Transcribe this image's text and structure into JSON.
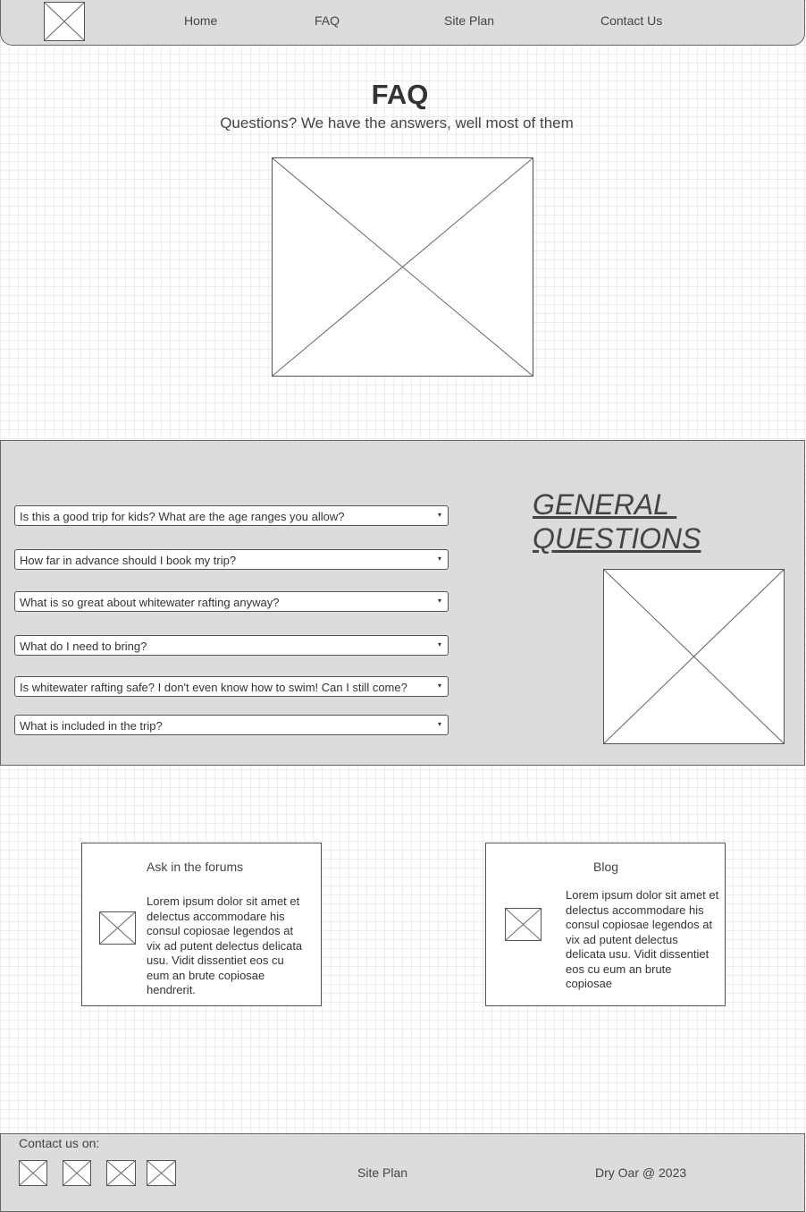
{
  "nav": {
    "home": "Home",
    "faq": "FAQ",
    "site_plan": "Site Plan",
    "contact": "Contact Us"
  },
  "hero": {
    "title": "FAQ",
    "subtitle": "Questions? We have the answers, well most of them"
  },
  "faq": {
    "questions": [
      " Is this a good trip for kids? What are the age ranges you allow?",
      "How far in advance should I book my trip?",
      "What is so great about whitewater rafting anyway?",
      "What do I need to bring?",
      "Is whitewater rafting safe? I don't even know how to swim! Can I still come?",
      "What is included in the trip?"
    ],
    "caret": "▾",
    "heading_line1": "GENERAL ",
    "heading_line2": "QUESTIONS"
  },
  "cards": [
    {
      "title": "Ask in the forums",
      "body": "Lorem ipsum dolor sit amet et delectus accommodare his consul copiosae legendos at vix ad putent delectus delicata usu. Vidit dissentiet eos cu eum an brute copiosae hendrerit."
    },
    {
      "title": "Blog",
      "body": "Lorem ipsum dolor sit amet et delectus accommodare his consul copiosae legendos at vix ad putent delectus delicata usu. Vidit dissentiet eos cu eum an brute copiosae"
    }
  ],
  "footer": {
    "contact_label": "Contact us on:",
    "site_plan": "Site Plan",
    "copyright": "Dry Oar @ 2023"
  }
}
